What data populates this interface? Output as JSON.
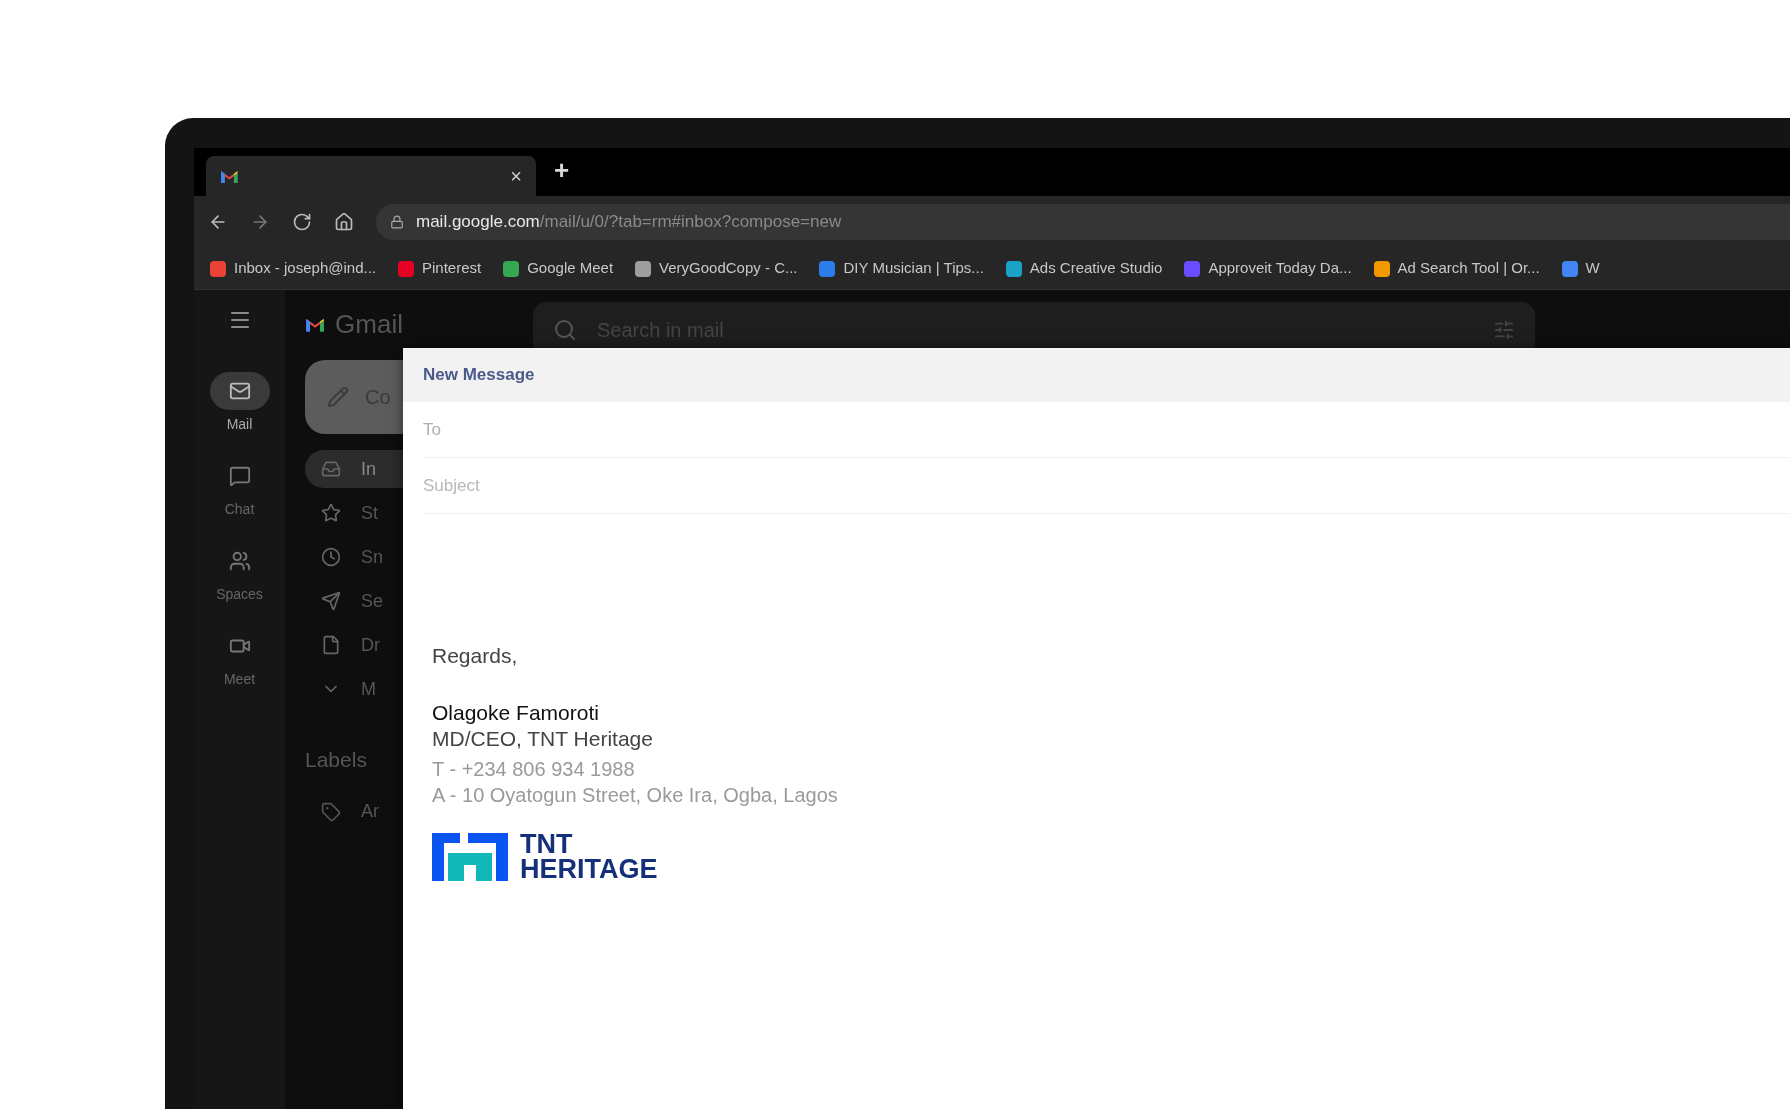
{
  "browser": {
    "tab": {
      "close": "×",
      "new_tab": "+"
    },
    "url_host": "mail.google.com",
    "url_path": "/mail/u/0/?tab=rm#inbox?compose=new",
    "bookmarks": [
      {
        "label": "Inbox - joseph@ind...",
        "color": "#ea4335"
      },
      {
        "label": "Pinterest",
        "color": "#e60023"
      },
      {
        "label": "Google Meet",
        "color": "#34a853"
      },
      {
        "label": "VeryGoodCopy - C...",
        "color": "#9e9e9e"
      },
      {
        "label": "DIY Musician | Tips...",
        "color": "#2b7de9"
      },
      {
        "label": "Ads Creative Studio",
        "color": "#1aa3c8"
      },
      {
        "label": "Approveit Today Da...",
        "color": "#6a4cff"
      },
      {
        "label": "Ad Search Tool | Or...",
        "color": "#f29900"
      },
      {
        "label": "W",
        "color": "#4285f4"
      }
    ]
  },
  "gmail": {
    "logo_text": "Gmail",
    "search": {
      "placeholder": "Search in mail"
    },
    "rail": [
      {
        "label": "Mail",
        "kind": "mail",
        "selected": true
      },
      {
        "label": "Chat",
        "kind": "chat",
        "selected": false
      },
      {
        "label": "Spaces",
        "kind": "spaces",
        "selected": false
      },
      {
        "label": "Meet",
        "kind": "meet",
        "selected": false
      }
    ],
    "compose_button": "Co",
    "nav": [
      {
        "label": "In",
        "kind": "inbox",
        "selected": true
      },
      {
        "label": "St",
        "kind": "starred",
        "selected": false
      },
      {
        "label": "Sn",
        "kind": "snoozed",
        "selected": false
      },
      {
        "label": "Se",
        "kind": "sent",
        "selected": false
      },
      {
        "label": "Dr",
        "kind": "drafts",
        "selected": false
      },
      {
        "label": "M",
        "kind": "more",
        "selected": false
      }
    ],
    "labels_heading": "Labels",
    "labels": [
      {
        "label": "Ar"
      }
    ]
  },
  "compose": {
    "title": "New Message",
    "to": {
      "placeholder": "To"
    },
    "subject": {
      "placeholder": "Subject"
    },
    "greeting": "Regards,",
    "signature": {
      "name": "Olagoke Famoroti",
      "role": "MD/CEO, TNT Heritage",
      "phone": "T - +234 806 934 1988",
      "address": "A - 10 Oyatogun Street, Oke Ira, Ogba, Lagos",
      "logo_line_1": "TNT",
      "logo_line_2": "HERITAGE"
    }
  }
}
